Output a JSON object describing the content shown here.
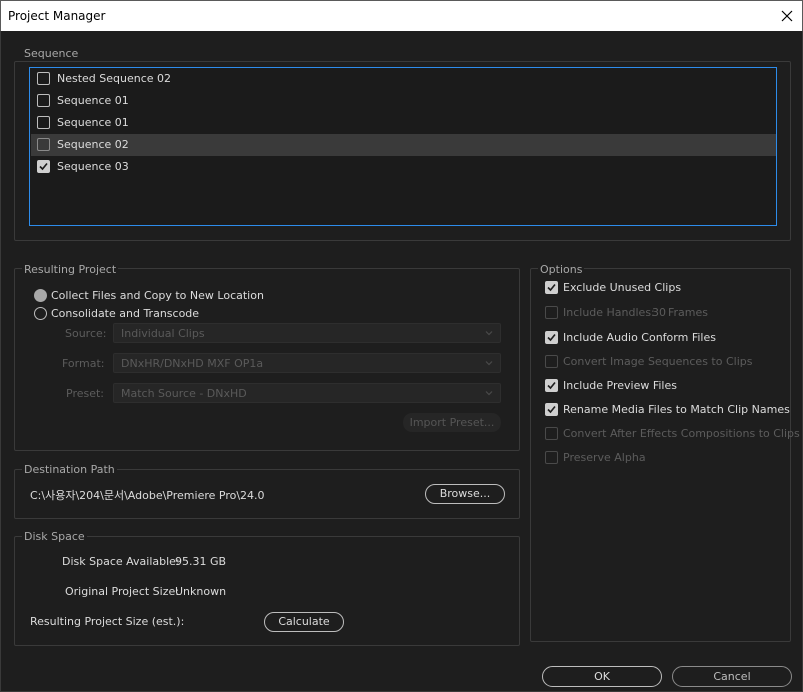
{
  "window": {
    "title": "Project Manager"
  },
  "sequence": {
    "label": "Sequence",
    "items": [
      {
        "label": "Nested Sequence 02",
        "checked": false
      },
      {
        "label": "Sequence 01",
        "checked": false
      },
      {
        "label": "Sequence 01",
        "checked": false
      },
      {
        "label": "Sequence 02",
        "checked": false,
        "selected": true
      },
      {
        "label": "Sequence 03",
        "checked": true
      }
    ]
  },
  "resulting_project": {
    "label": "Resulting Project",
    "option_collect": "Collect Files and Copy to New Location",
    "option_consolidate": "Consolidate and Transcode",
    "source_label": "Source:",
    "source_value": "Individual Clips",
    "format_label": "Format:",
    "format_value": "DNxHR/DNxHD MXF OP1a",
    "preset_label": "Preset:",
    "preset_value": "Match Source - DNxHD",
    "import_preset": "Import Preset..."
  },
  "options": {
    "label": "Options",
    "exclude_unused": "Exclude Unused Clips",
    "include_handles": "Include Handles:",
    "handles_value": "30",
    "handles_unit": "Frames",
    "include_audio_conform": "Include Audio Conform Files",
    "convert_image_sequences": "Convert Image Sequences to Clips",
    "include_preview": "Include Preview Files",
    "rename_media": "Rename Media Files to Match Clip Names",
    "convert_ae": "Convert After Effects Compositions to Clips",
    "preserve_alpha": "Preserve Alpha"
  },
  "destination": {
    "label": "Destination Path",
    "path": "C:\\사용자\\204\\문서\\Adobe\\Premiere Pro\\24.0",
    "browse": "Browse..."
  },
  "disk_space": {
    "label": "Disk Space",
    "available_label": "Disk Space Available:",
    "available_value": "95.31 GB",
    "original_label": "Original Project Size:",
    "original_value": "Unknown",
    "resulting_label": "Resulting Project Size (est.):",
    "calculate": "Calculate"
  },
  "footer": {
    "ok": "OK",
    "cancel": "Cancel"
  },
  "colors": {
    "accent": "#2d8ceb",
    "background": "#1e1e1e",
    "selected_row": "#3a3a3a"
  }
}
